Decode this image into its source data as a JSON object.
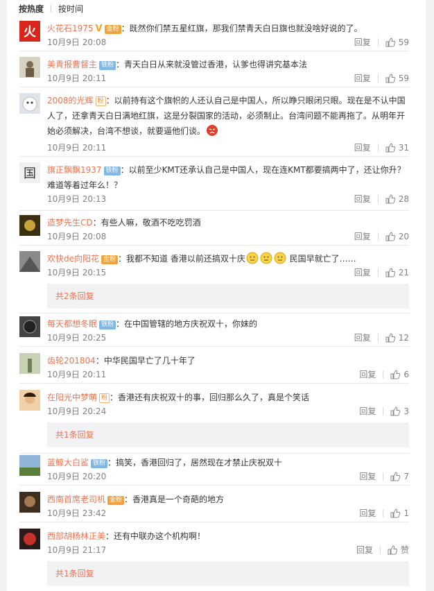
{
  "sort": {
    "hot_label": "按热度",
    "time_label": "按时间"
  },
  "action_labels": {
    "reply": "回复"
  },
  "comments": [
    {
      "name": "火花石1975",
      "badge": "金粉",
      "text": "：既然你们禁五星红旗，那我们禁青天白日旗也就没啥好说的了。",
      "time": "10月9日 20:08",
      "likes": "59"
    },
    {
      "name": "美青报曹督主",
      "badge": "铁粉",
      "text": "：青天白日从来就没管过香港，认爹也得讲究基本法",
      "time": "10月9日 20:11",
      "likes": "59"
    },
    {
      "name": "2008的光辉",
      "badge": "",
      "text_line1": "：以前持有这个旗帜的人还认自己是中国人，所以睁只眼闭只眼。现在是不认中国",
      "text_line2": "人了，还拿青天白日满地红旗，这是分裂国家的活动，必须制止。台湾问题不能再拖了。从明年开",
      "text_line3": "始必须解决，台湾不想谈，就要逼他们谈。",
      "time": "10月9日 20:11",
      "likes": "31"
    },
    {
      "name": "旗正飘飘1937",
      "badge": "铁粉",
      "text_line1": "：以前至少KMT还承认自己是中国人，现在连KMT都要搞两中了，还让你升？",
      "text_line2": "难道等着过年么！？",
      "time": "10月9日 20:13",
      "likes": "28"
    },
    {
      "name": "造梦先生CD",
      "badge": "",
      "text": "：有些人嘛，敬酒不吃吃罚酒",
      "time": "10月9日 20:08",
      "likes": "20"
    },
    {
      "name": "欢快de向阳花",
      "badge": "金粉",
      "text_a": "：我都不知道 香港以前还搞双十庆",
      "text_b": " 民国早就亡了……",
      "time": "10月9日 20:15",
      "likes": "21",
      "replies": "共2条回复"
    },
    {
      "name": "每天都想冬眠",
      "badge": "铁粉",
      "text": "：在中国管辖的地方庆祝双十，你妹的",
      "time": "10月9日 20:25",
      "likes": "12"
    },
    {
      "name": "齿轮201804",
      "badge": "",
      "text": "：中华民国早亡了几十年了",
      "time": "10月9日 20:11",
      "likes": "6"
    },
    {
      "name": "在阳光中梦萌",
      "badge": "",
      "text": "：香港还有庆祝双十的事，回归那么久了，真是个笑话",
      "time": "10月9日 20:24",
      "likes": "3",
      "replies": "共1条回复"
    },
    {
      "name": "蓝鲸大白鲨",
      "badge": "铁粉",
      "text": "：搞笑，香港回归了，居然现在才禁止庆祝双十",
      "time": "10月9日 20:20",
      "likes": "7"
    },
    {
      "name": "西南首席老司机",
      "badge": "金粉",
      "text": "：香港真是一个奇葩的地方",
      "time": "10月9日 23:42",
      "likes": "1"
    },
    {
      "name": "西部胡杨林正美",
      "badge": "",
      "text": "：还有中联办这个机构啊！",
      "time": "10月9日 21:17",
      "likes": "赞",
      "replies": "共1条回复"
    }
  ],
  "colors": {
    "username": "#eb7350",
    "meta": "#808080",
    "reply_bg": "#f2f2f5",
    "tie_badge": "#7fb7e5"
  },
  "icons": {
    "like": "thumbs-up-icon",
    "vip": "v-verified-icon",
    "fan": "fan-badge-icon",
    "emoji": "emoji-face-icon",
    "angry": "angry-emoji-icon"
  }
}
